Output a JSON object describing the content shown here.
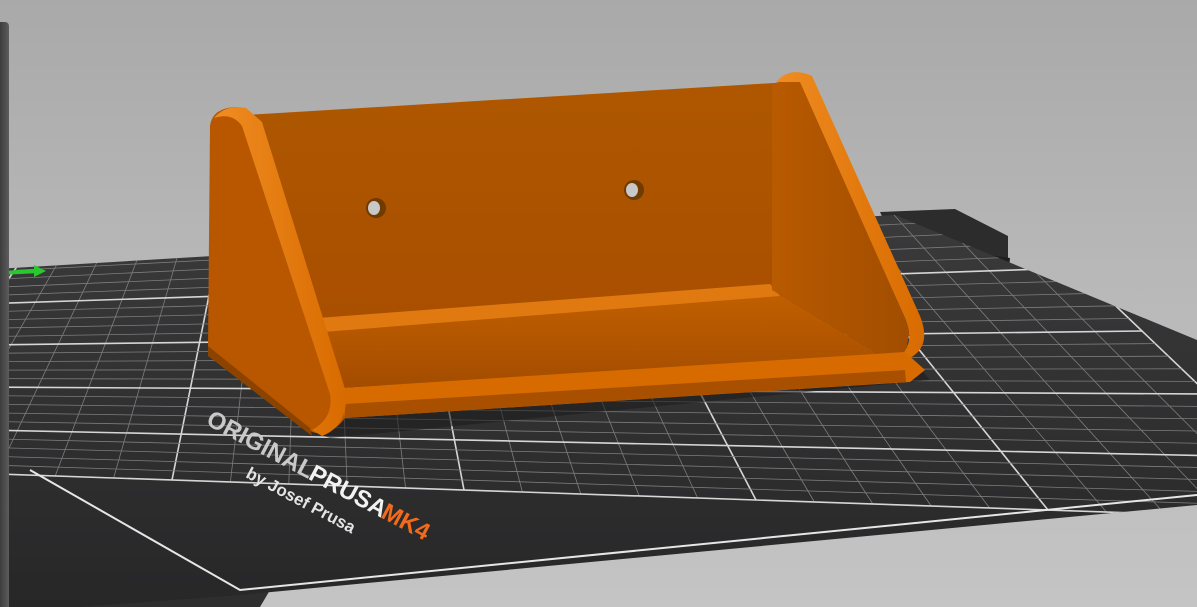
{
  "viewport": {
    "background_color": "#b4b4b4",
    "bed_color": "#2f2f30",
    "grid_color": "#8a8a8a",
    "model_color": "#d96a00",
    "axis_color": "#29c82e"
  },
  "bed_logo": {
    "line1_part1": "ORIGINAL",
    "line1_part2": "PRUSA",
    "line1_part3": "MK4",
    "line2": "by Josef Prusa",
    "accent_color": "#f26a1b"
  },
  "model": {
    "name": "wall shelf"
  }
}
